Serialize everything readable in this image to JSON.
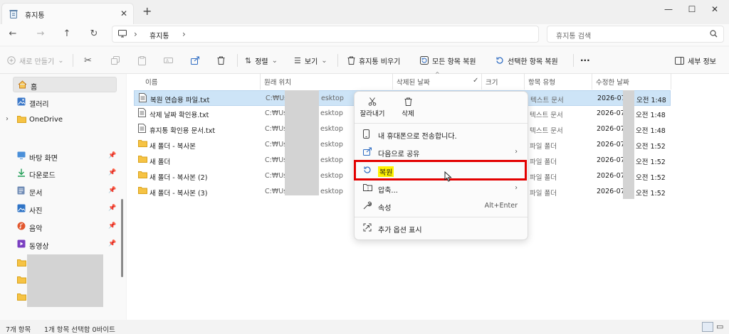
{
  "window": {
    "tab_title": "휴지통",
    "new_tab": "+",
    "tab_close": "✕",
    "minimize": "—",
    "maximize": "☐",
    "close": "✕"
  },
  "address": {
    "crumb": "휴지통",
    "search_placeholder": "휴지통 검색"
  },
  "toolbar": {
    "new": "새로 만들기",
    "sort": "정렬",
    "view": "보기",
    "empty_bin": "휴지통 비우기",
    "restore_all": "모든 항목 복원",
    "restore_selected": "선택한 항목 복원",
    "more": "···",
    "details": "세부 정보"
  },
  "sidebar": {
    "home": "홈",
    "gallery": "갤러리",
    "onedrive": "OneDrive",
    "quick": [
      {
        "label": "바탕 화면",
        "icon": "desktop-icon"
      },
      {
        "label": "다운로드",
        "icon": "download-icon"
      },
      {
        "label": "문서",
        "icon": "documents-icon"
      },
      {
        "label": "사진",
        "icon": "pictures-icon"
      },
      {
        "label": "음악",
        "icon": "music-icon"
      },
      {
        "label": "동영상",
        "icon": "videos-icon"
      }
    ]
  },
  "columns": {
    "name": "이름",
    "location": "원래 위치",
    "deleted": "삭제된 날짜",
    "size": "크기",
    "type": "항목 유형",
    "modified": "수정한 날짜"
  },
  "files": [
    {
      "name": "복원 연습용 파일.txt",
      "loc_a": "C:₩Use",
      "loc_b": "esktop",
      "type": "텍스트 문서",
      "date": "2026-07",
      "time": "오전 1:48",
      "icon": "text-file-icon",
      "selected": true
    },
    {
      "name": "삭제 날짜 확인용.txt",
      "loc_a": "C:₩Use",
      "loc_b": "esktop",
      "type": "텍스트 문서",
      "date": "2026-07",
      "time": "오전 1:48",
      "icon": "text-file-icon",
      "selected": false
    },
    {
      "name": "휴지통 확인용 문서.txt",
      "loc_a": "C:₩Use",
      "loc_b": "esktop",
      "type": "텍스트 문서",
      "date": "2026-07",
      "time": "오전 1:48",
      "icon": "text-file-icon",
      "selected": false
    },
    {
      "name": "새 폴더 - 복사본",
      "loc_a": "C:₩Use",
      "loc_b": "esktop",
      "type": "파일 폴더",
      "date": "2026-07",
      "time": "오전 1:52",
      "icon": "folder-icon",
      "selected": false
    },
    {
      "name": "새 폴더",
      "loc_a": "C:₩Use",
      "loc_b": "esktop",
      "type": "파일 폴더",
      "date": "2026-07",
      "time": "오전 1:52",
      "icon": "folder-icon",
      "selected": false
    },
    {
      "name": "새 폴더 - 복사본 (2)",
      "loc_a": "C:₩Use",
      "loc_b": "esktop",
      "type": "파일 폴더",
      "date": "2026-07",
      "time": "오전 1:52",
      "icon": "folder-icon",
      "selected": false
    },
    {
      "name": "새 폴더 - 복사본 (3)",
      "loc_a": "C:₩Use",
      "loc_b": "esktop",
      "type": "파일 폴더",
      "date": "2026-07",
      "time": "오전 1:52",
      "icon": "folder-icon",
      "selected": false
    }
  ],
  "context_menu": {
    "cut": "잘라내기",
    "delete": "삭제",
    "send_phone": "내 휴대폰으로 전송합니다.",
    "share": "다음으로 공유",
    "restore": "복원",
    "compress": "압축...",
    "properties": "속성",
    "properties_shortcut": "Alt+Enter",
    "more_options": "추가 옵션 표시"
  },
  "status": {
    "count": "7개 항목",
    "selection": "1개 항목 선택함 0바이트"
  },
  "colors": {
    "highlight_border": "#e30000",
    "highlight_fill": "#fff200",
    "selection": "#cde4f7"
  }
}
